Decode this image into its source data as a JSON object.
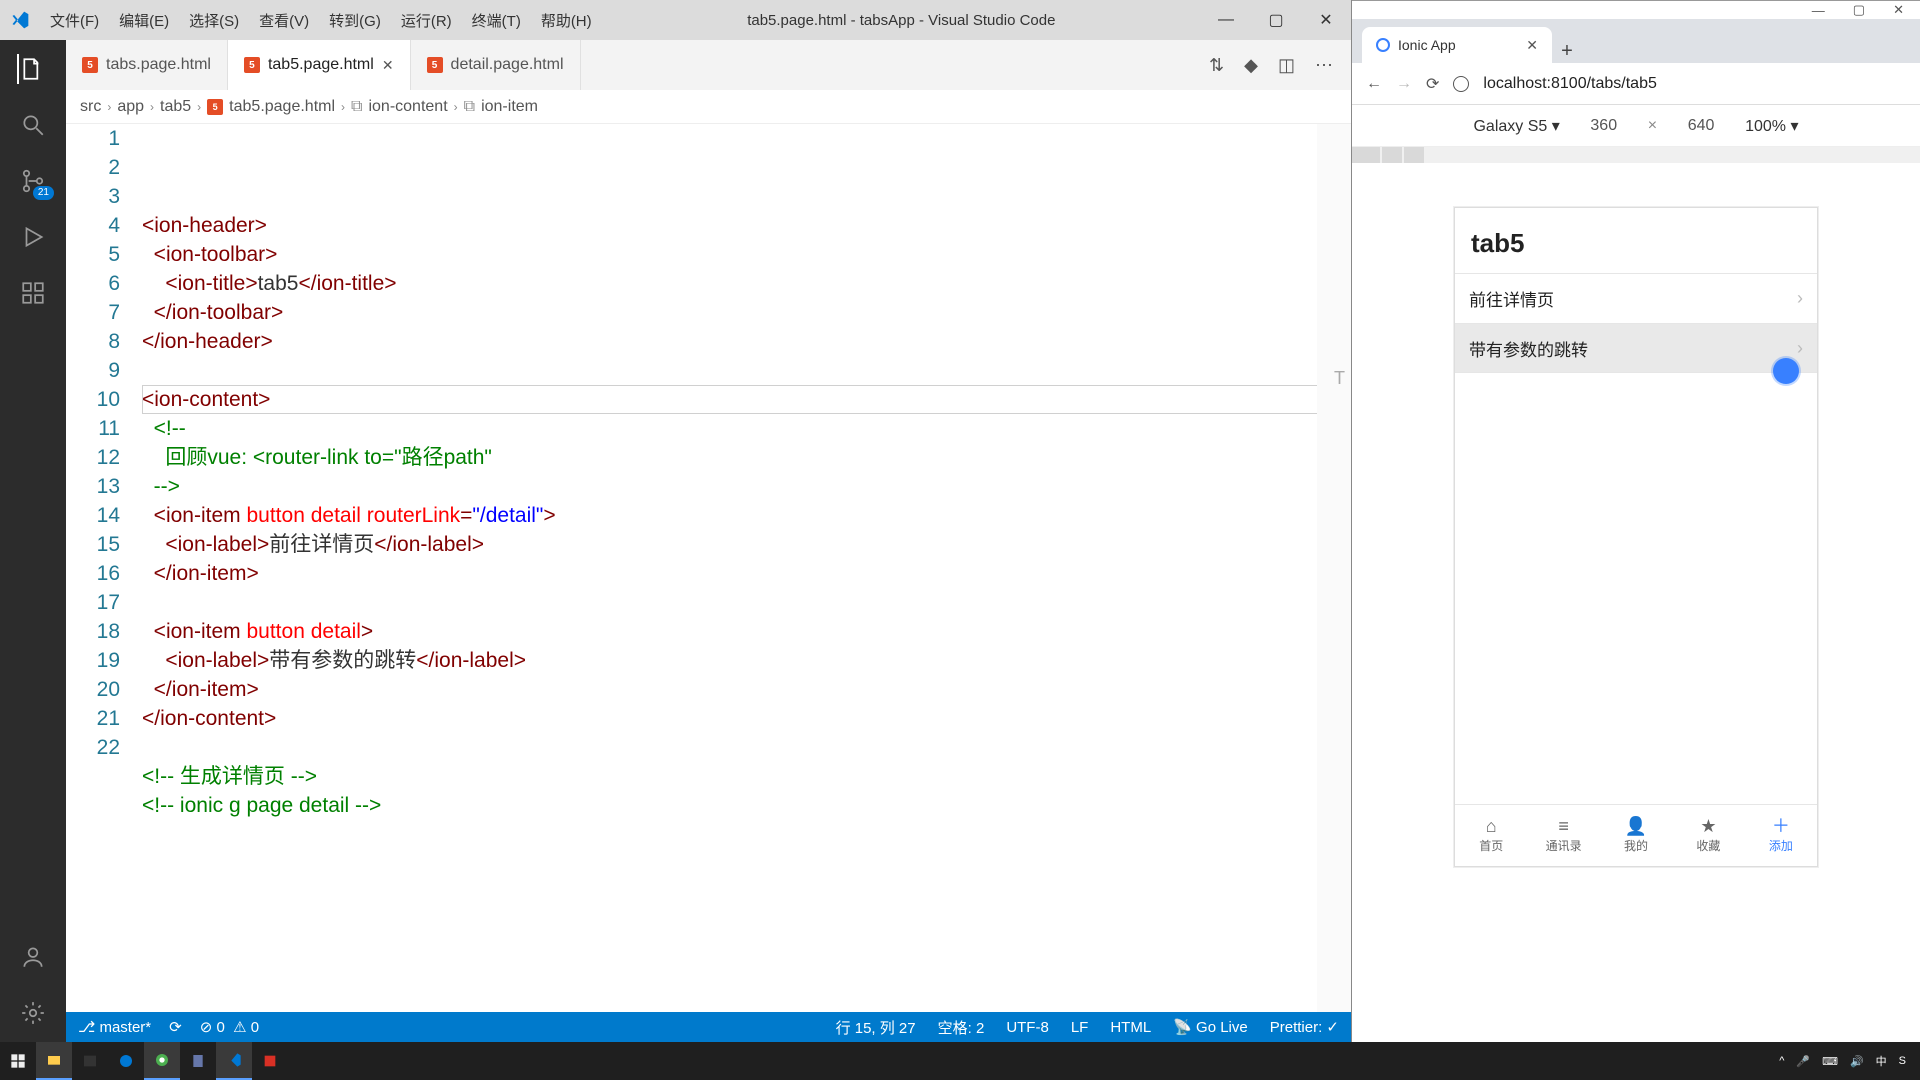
{
  "vscode": {
    "menu": [
      "文件(F)",
      "编辑(E)",
      "选择(S)",
      "查看(V)",
      "转到(G)",
      "运行(R)",
      "终端(T)",
      "帮助(H)"
    ],
    "title": "tab5.page.html - tabsApp - Visual Studio Code",
    "scm_badge": "21",
    "tabs": [
      {
        "label": "tabs.page.html",
        "active": false
      },
      {
        "label": "tab5.page.html",
        "active": true
      },
      {
        "label": "detail.page.html",
        "active": false
      }
    ],
    "breadcrumb": [
      "src",
      "app",
      "tab5",
      "tab5.page.html",
      "ion-content",
      "ion-item"
    ],
    "code": {
      "lines": [
        {
          "n": 1,
          "seg": [
            [
              "<",
              "punc"
            ],
            [
              "ion-header",
              "tag"
            ],
            [
              ">",
              "punc"
            ]
          ],
          "ind": 0
        },
        {
          "n": 2,
          "seg": [
            [
              "<",
              "punc"
            ],
            [
              "ion-toolbar",
              "tag"
            ],
            [
              ">",
              "punc"
            ]
          ],
          "ind": 1
        },
        {
          "n": 3,
          "seg": [
            [
              "<",
              "punc"
            ],
            [
              "ion-title",
              "tag"
            ],
            [
              ">",
              "punc"
            ],
            [
              "tab5",
              ""
            ],
            [
              "</",
              "punc"
            ],
            [
              "ion-title",
              "tag"
            ],
            [
              ">",
              "punc"
            ]
          ],
          "ind": 2
        },
        {
          "n": 4,
          "seg": [
            [
              "</",
              "punc"
            ],
            [
              "ion-toolbar",
              "tag"
            ],
            [
              ">",
              "punc"
            ]
          ],
          "ind": 1
        },
        {
          "n": 5,
          "seg": [
            [
              "</",
              "punc"
            ],
            [
              "ion-header",
              "tag"
            ],
            [
              ">",
              "punc"
            ]
          ],
          "ind": 0
        },
        {
          "n": 6,
          "seg": [],
          "ind": 0
        },
        {
          "n": 7,
          "seg": [
            [
              "<",
              "punc"
            ],
            [
              "ion-content",
              "tag"
            ],
            [
              ">",
              "punc"
            ]
          ],
          "ind": 0
        },
        {
          "n": 8,
          "seg": [
            [
              "<!--",
              "cmt"
            ]
          ],
          "ind": 1
        },
        {
          "n": 9,
          "seg": [
            [
              "回顾vue: <router-link to=\"路径path\"",
              "cmt"
            ]
          ],
          "ind": 2
        },
        {
          "n": 10,
          "seg": [
            [
              "-->",
              "cmt"
            ]
          ],
          "ind": 1
        },
        {
          "n": 11,
          "seg": [
            [
              "<",
              "punc"
            ],
            [
              "ion-item",
              "tag"
            ],
            [
              " ",
              ""
            ],
            [
              "button",
              "attr"
            ],
            [
              " ",
              ""
            ],
            [
              "detail",
              "attr"
            ],
            [
              " ",
              ""
            ],
            [
              "routerLink",
              "attr"
            ],
            [
              "=",
              "punc"
            ],
            [
              "\"/detail\"",
              "str"
            ],
            [
              ">",
              "punc"
            ]
          ],
          "ind": 1
        },
        {
          "n": 12,
          "seg": [
            [
              "<",
              "punc"
            ],
            [
              "ion-label",
              "tag"
            ],
            [
              ">",
              "punc"
            ],
            [
              "前往详情页",
              ""
            ],
            [
              "</",
              "punc"
            ],
            [
              "ion-label",
              "tag"
            ],
            [
              ">",
              "punc"
            ]
          ],
          "ind": 2
        },
        {
          "n": 13,
          "seg": [
            [
              "</",
              "punc"
            ],
            [
              "ion-item",
              "tag"
            ],
            [
              ">",
              "punc"
            ]
          ],
          "ind": 1
        },
        {
          "n": 14,
          "seg": [],
          "ind": 0
        },
        {
          "n": 15,
          "seg": [
            [
              "<",
              "punc"
            ],
            [
              "ion-item",
              "tag"
            ],
            [
              " ",
              ""
            ],
            [
              "button",
              "attr"
            ],
            [
              " ",
              ""
            ],
            [
              "detail",
              "attr"
            ],
            [
              ">",
              "punc"
            ]
          ],
          "ind": 1
        },
        {
          "n": 16,
          "seg": [
            [
              "<",
              "punc"
            ],
            [
              "ion-label",
              "tag"
            ],
            [
              ">",
              "punc"
            ],
            [
              "带有参数的跳转",
              ""
            ],
            [
              "</",
              "punc"
            ],
            [
              "ion-label",
              "tag"
            ],
            [
              ">",
              "punc"
            ]
          ],
          "ind": 2
        },
        {
          "n": 17,
          "seg": [
            [
              "</",
              "punc"
            ],
            [
              "ion-item",
              "tag"
            ],
            [
              ">",
              "punc"
            ]
          ],
          "ind": 1
        },
        {
          "n": 18,
          "seg": [
            [
              "</",
              "punc"
            ],
            [
              "ion-content",
              "tag"
            ],
            [
              ">",
              "punc"
            ]
          ],
          "ind": 0
        },
        {
          "n": 19,
          "seg": [],
          "ind": 0
        },
        {
          "n": 20,
          "seg": [
            [
              "<!-- 生成详情页 -->",
              "cmt"
            ]
          ],
          "ind": 0
        },
        {
          "n": 21,
          "seg": [
            [
              "<!-- ionic g page detail -->",
              "cmt"
            ]
          ],
          "ind": 0
        },
        {
          "n": 22,
          "seg": [],
          "ind": 0
        }
      ]
    },
    "status": {
      "branch": "master*",
      "errors": "0",
      "warnings": "0",
      "cursor": "行 15, 列 27",
      "spaces": "空格: 2",
      "encoding": "UTF-8",
      "eol": "LF",
      "lang": "HTML",
      "golive": "Go Live",
      "prettier": "Prettier: ✓"
    }
  },
  "browser": {
    "tab_title": "Ionic App",
    "url": "localhost:8100/tabs/tab5",
    "device_name": "Galaxy S5",
    "dim_w": "360",
    "dim_h": "640",
    "zoom": "100%",
    "app": {
      "title": "tab5",
      "items": [
        {
          "label": "前往详情页",
          "hover": false
        },
        {
          "label": "带有参数的跳转",
          "hover": true
        }
      ],
      "tabs": [
        {
          "icon": "⌂",
          "label": "首页"
        },
        {
          "icon": "≡",
          "label": "通讯录"
        },
        {
          "icon": "👤",
          "label": "我的"
        },
        {
          "icon": "★",
          "label": "收藏"
        },
        {
          "icon": "＋",
          "label": "添加",
          "active": true
        }
      ]
    }
  },
  "taskbar": {
    "tray": [
      "^",
      "🎤",
      "⌨",
      "🔊",
      "中",
      "S"
    ],
    "time": ""
  }
}
